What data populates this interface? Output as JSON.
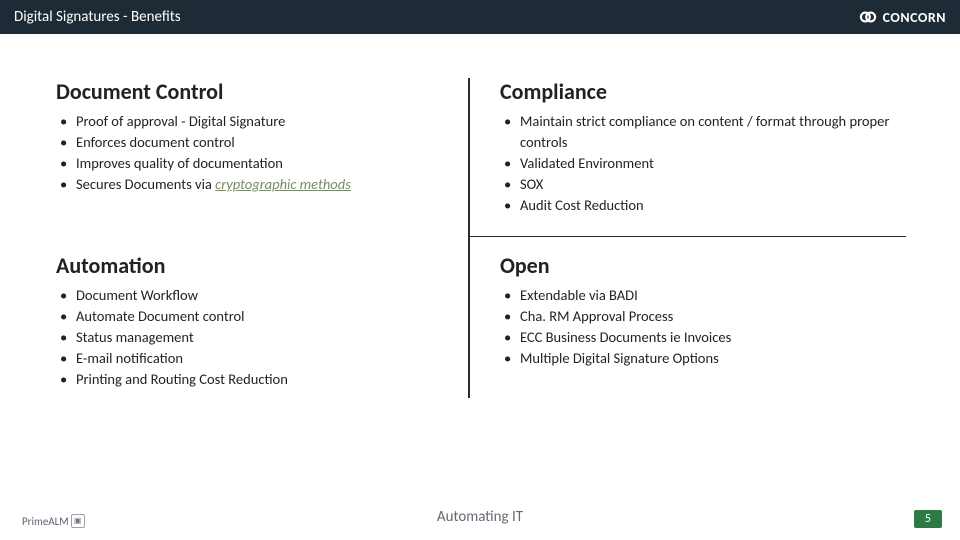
{
  "header": {
    "title": "Digital Signatures - Benefits",
    "company": "CONCORN"
  },
  "quadrants": {
    "document_control": {
      "heading": "Document Control",
      "items": [
        {
          "text": "Proof of approval - Digital Signature"
        },
        {
          "text": "Enforces document control"
        },
        {
          "text": "Improves quality of documentation"
        },
        {
          "text_prefix": "Secures Documents via ",
          "emphasis": "cryptographic methods"
        }
      ]
    },
    "compliance": {
      "heading": "Compliance",
      "items": [
        {
          "text": "Maintain strict compliance on content / format through proper controls"
        },
        {
          "text": "Validated Environment"
        },
        {
          "text": "SOX"
        },
        {
          "text": "Audit Cost Reduction"
        }
      ]
    },
    "automation": {
      "heading": "Automation",
      "items": [
        {
          "text": "Document Workflow"
        },
        {
          "text": "Automate Document control"
        },
        {
          "text": "Status management"
        },
        {
          "text": "E-mail notification"
        },
        {
          "text": "Printing and Routing Cost Reduction"
        }
      ]
    },
    "open": {
      "heading": "Open",
      "items": [
        {
          "text": "Extendable via BADI"
        },
        {
          "text": "Cha. RM Approval Process"
        },
        {
          "text": "ECC Business Documents ie Invoices"
        },
        {
          "text": "Multiple Digital Signature Options"
        }
      ]
    }
  },
  "footer": {
    "left_logo_text": "PrimeALM",
    "center_text": "Automating IT",
    "page_number": "5"
  },
  "colors": {
    "header_bg": "#1e2a35",
    "divider": "#2a2a2a",
    "footer_text": "#616a73",
    "page_badge_bg": "#2e7a44",
    "emphasis_color": "#7a8a6a"
  }
}
